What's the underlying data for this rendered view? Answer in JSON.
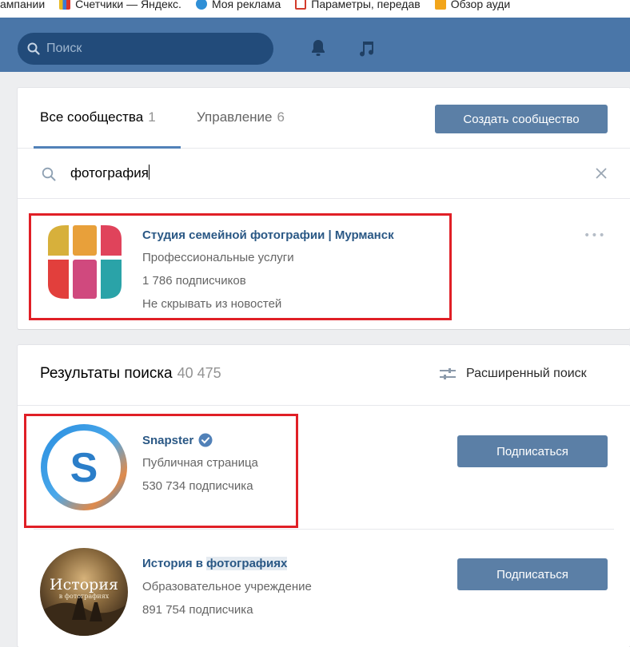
{
  "bookmarks": [
    {
      "label": "ампании",
      "icon": "none",
      "color": ""
    },
    {
      "label": "Счетчики — Яндекс.",
      "icon": "bar-chart-icon",
      "color": "#e8b820"
    },
    {
      "label": "Моя реклама",
      "icon": "globe-icon",
      "color": "#2f8fd6"
    },
    {
      "label": "Параметры, передав",
      "icon": "document-icon",
      "color": "#d33b2c"
    },
    {
      "label": "Обзор ауди",
      "icon": "bar-chart-icon",
      "color": "#f2a51a"
    }
  ],
  "header": {
    "search_placeholder": "Поиск",
    "icons": [
      "search-icon",
      "bell-icon",
      "music-icon"
    ]
  },
  "tabs": {
    "all": {
      "label": "Все сообщества",
      "count": "1"
    },
    "manage": {
      "label": "Управление",
      "count": "6"
    },
    "create_button": "Создать сообщество"
  },
  "search": {
    "query": "фотография",
    "icons": [
      "search-icon",
      "close-icon"
    ]
  },
  "my_community": {
    "title": "Студия семейной фотографии | Мурманск",
    "category": "Профессиональные услуги",
    "subscribers": "1 786 подписчиков",
    "status": "Не скрывать из новостей",
    "menu": "•••"
  },
  "results": {
    "title": "Результаты поиска",
    "count": "40 475",
    "advanced_label": "Расширенный поиск",
    "items": [
      {
        "title": "Snapster",
        "verified": true,
        "category": "Публичная страница",
        "subscribers": "530 734 подписчика",
        "button": "Подписаться",
        "logo_letter": "S"
      },
      {
        "title_plain": "История в ",
        "title_highlight": "фотографиях",
        "category": "Образовательное учреждение",
        "subscribers": "891 754 подписчика",
        "button": "Подписаться",
        "logo_text_1": "История",
        "logo_text_2": "в фотографиях"
      }
    ]
  },
  "colors": {
    "header": "#4a76a8",
    "accent": "#5181b8",
    "button": "#5b7fa6",
    "link": "#2a5885",
    "highlight_border": "#e01f26"
  }
}
